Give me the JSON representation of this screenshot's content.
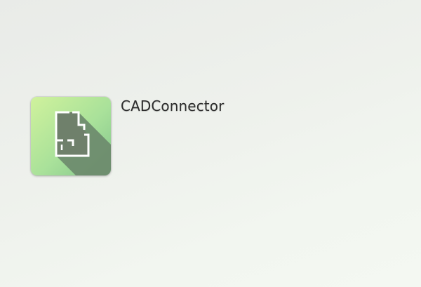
{
  "app": {
    "name": "CADConnector",
    "icon": "floor-plan-icon",
    "colors": {
      "tile_gradient_start": "#c9ef96",
      "tile_gradient_end": "#86c98e",
      "shadow": "#6d8a6c",
      "plan_fill": "#6f806b",
      "plan_stroke": "#ffffff"
    }
  }
}
